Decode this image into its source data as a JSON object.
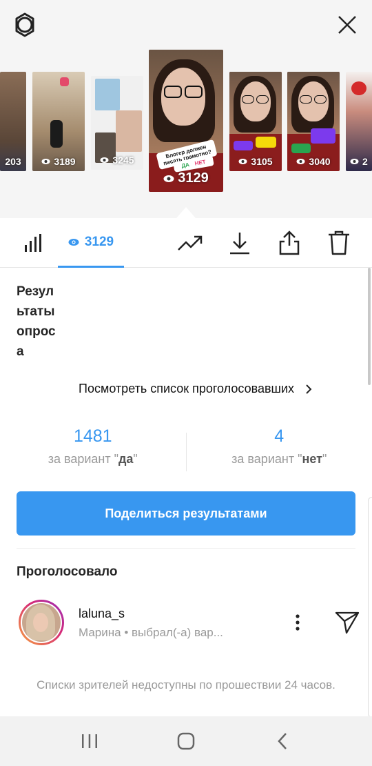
{
  "header": {
    "settings_icon": "gear-icon",
    "close_icon": "close-icon"
  },
  "stories": [
    {
      "views": "203"
    },
    {
      "views": "3189"
    },
    {
      "views": "3245"
    },
    {
      "views": "3129",
      "question": "Блогер должен писать грамотно?",
      "opt_yes": "ДА",
      "opt_no": "НЕТ"
    },
    {
      "views": "3105"
    },
    {
      "views": "3040"
    },
    {
      "views": "2"
    }
  ],
  "toolbar": {
    "insights_icon": "bar-chart-icon",
    "views_tab_count": "3129",
    "promote_icon": "trending-up-icon",
    "download_icon": "download-icon",
    "share_icon": "share-icon",
    "delete_icon": "trash-icon"
  },
  "poll": {
    "title": "Результаты опроса",
    "view_voters_link": "Посмотреть список проголосовавших",
    "options": [
      {
        "count": "1481",
        "label_prefix": "за вариант \"",
        "option": "да",
        "label_suffix": "\""
      },
      {
        "count": "4",
        "label_prefix": "за вариант \"",
        "option": "нет",
        "label_suffix": "\""
      }
    ],
    "share_button": "Поделиться результатами"
  },
  "voters": {
    "heading": "Проголосовало",
    "items": [
      {
        "username": "laluna_s",
        "detail": "Марина • выбрал(-а) вар..."
      }
    ]
  },
  "footer_note": "Списки зрителей недоступны по прошествии 24 часов.",
  "colors": {
    "accent": "#3897f0",
    "active_story_bg": "#b22424"
  }
}
